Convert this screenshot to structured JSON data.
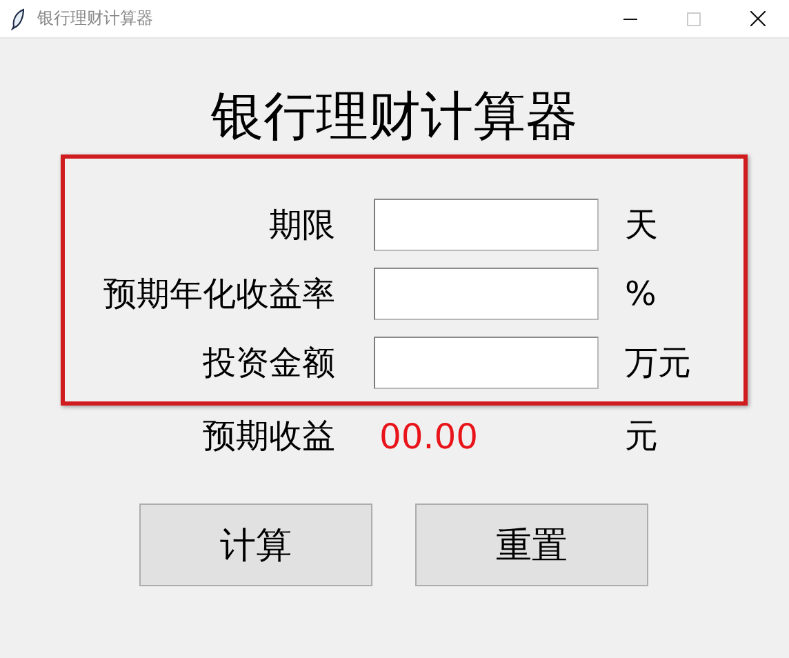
{
  "window": {
    "title": "银行理财计算器"
  },
  "heading": "银行理财计算器",
  "fields": [
    {
      "label": "期限",
      "unit": "天"
    },
    {
      "label": "预期年化收益率",
      "unit": "%"
    },
    {
      "label": "投资金额",
      "unit": "万元"
    }
  ],
  "result": {
    "label": "预期收益",
    "value": "00.00",
    "unit": "元"
  },
  "buttons": [
    "计算",
    "重置"
  ]
}
